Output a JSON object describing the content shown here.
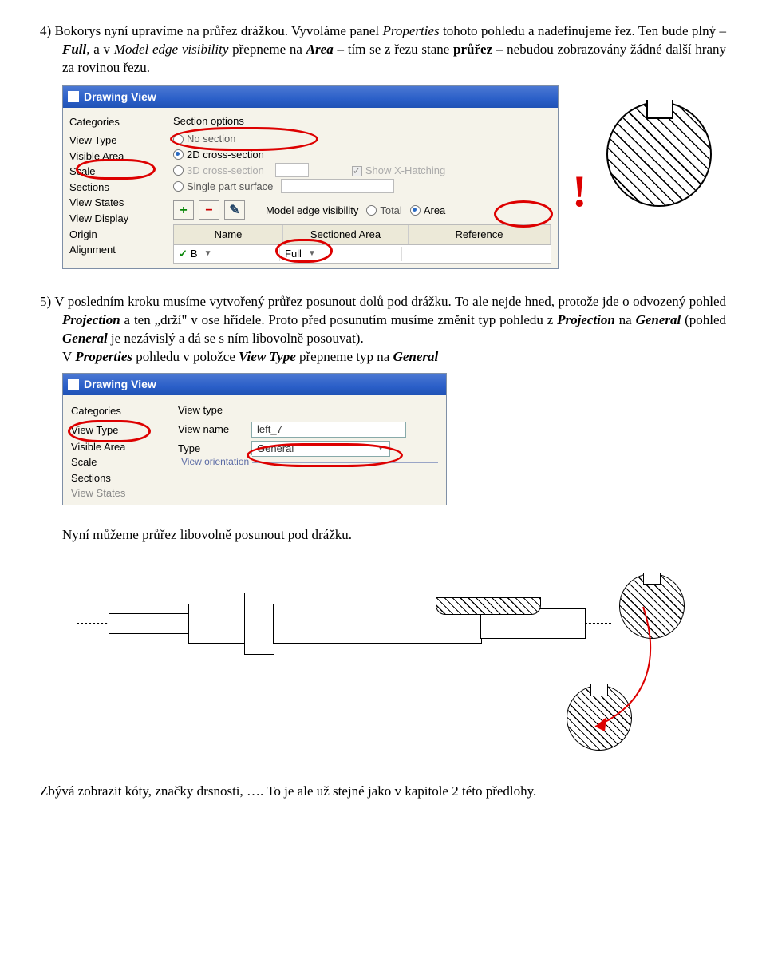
{
  "para4": {
    "num": "4)",
    "t1": "Bokorys nyní upravíme na průřez drážkou. Vyvoláme panel ",
    "prop": "Properties",
    "t2": " tohoto pohledu a nadefinujeme řez. Ten bude plný – ",
    "full": "Full",
    "t3": ", a v ",
    "mev": "Model edge visibility",
    "t4": " přepneme na ",
    "area": "Area",
    "t5": " – tím se z řezu stane ",
    "pr": "průřez",
    "t6": " – nebudou zobrazovány žádné další hrany za rovinou řezu."
  },
  "panel1": {
    "title": "Drawing View",
    "catlabel": "Categories",
    "cats": [
      "View Type",
      "Visible Area",
      "Scale",
      "Sections",
      "View States",
      "View Display",
      "Origin",
      "Alignment"
    ],
    "sectopts": "Section options",
    "r1": "No section",
    "r2": "2D cross-section",
    "r3": "3D cross-section",
    "r4": "Single part surface",
    "showx": "Show X-Hatching",
    "mevlabel": "Model edge visibility",
    "total": "Total",
    "arealbl": "Area",
    "thName": "Name",
    "thSect": "Sectioned Area",
    "thRef": "Reference",
    "rowName": "B",
    "rowSect": "Full",
    "excl": "!"
  },
  "para5": {
    "num": "5)",
    "t1": "V posledním kroku musíme vytvořený průřez posunout dolů pod drážku. To ale nejde hned, protože jde o odvozený pohled ",
    "proj": "Projection",
    "t2": " a ten „drží\" v ose hřídele. Proto před posunutím musíme změnit typ pohledu z ",
    "proj2": "Projection",
    "t3": " na ",
    "gen": "General",
    "t4": " (pohled ",
    "gen2": "General",
    "t5": " je nezávislý a dá se s ním libovolně posouvat).",
    "t6a": "V ",
    "prop": "Properties",
    "t6b": " pohledu v položce ",
    "vt": "View Type",
    "t6c": " přepneme typ na ",
    "gen3": "General"
  },
  "panel2": {
    "title": "Drawing View",
    "catlabel": "Categories",
    "cats": [
      "View Type",
      "Visible Area",
      "Scale",
      "Sections",
      "View States"
    ],
    "vtlabel": "View type",
    "vnlabel": "View name",
    "vnval": "left_7",
    "typelabel": "Type",
    "typeval": "General",
    "grp": "View orientation"
  },
  "mid": "Nyní můžeme průřez libovolně posunout pod drážku.",
  "final": "Zbývá zobrazit kóty, značky drsnosti, …. To je ale už stejné jako v kapitole 2 této předlohy."
}
